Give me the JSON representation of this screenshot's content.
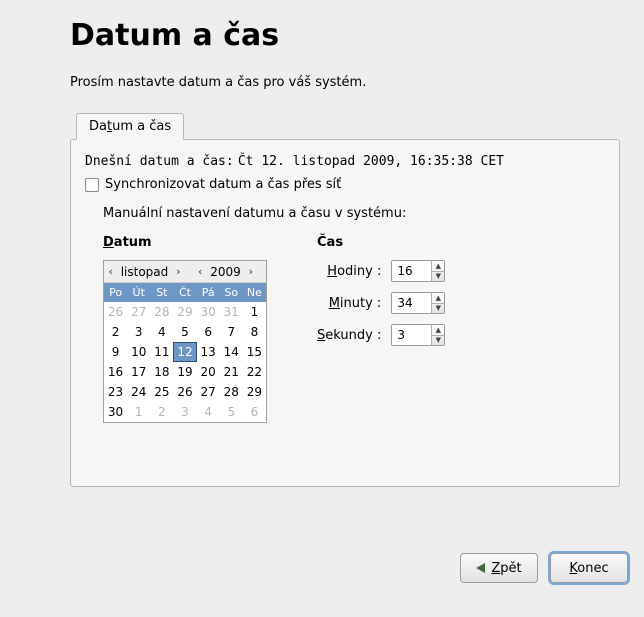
{
  "title": "Datum a čas",
  "subtitle": "Prosím nastavte datum a čas pro váš systém.",
  "tab_label": "Datum a čas",
  "current_label": "Dnešní datum a čas:",
  "current_value": "Čt 12. listopad 2009, 16:35:38 CET",
  "sync_label": "Synchronizovat datum a čas přes síť",
  "manual_label": "Manuální nastavení datumu a času v systému:",
  "date_heading": "Datum",
  "time_heading": "Čas",
  "calendar": {
    "month": "listopad",
    "year": "2009",
    "weekdays": [
      "Po",
      "Út",
      "St",
      "Čt",
      "Pá",
      "So",
      "Ne"
    ],
    "rows": [
      [
        {
          "d": "26",
          "o": true
        },
        {
          "d": "27",
          "o": true
        },
        {
          "d": "28",
          "o": true
        },
        {
          "d": "29",
          "o": true
        },
        {
          "d": "30",
          "o": true
        },
        {
          "d": "31",
          "o": true
        },
        {
          "d": "1"
        }
      ],
      [
        {
          "d": "2"
        },
        {
          "d": "3"
        },
        {
          "d": "4"
        },
        {
          "d": "5"
        },
        {
          "d": "6"
        },
        {
          "d": "7"
        },
        {
          "d": "8"
        }
      ],
      [
        {
          "d": "9"
        },
        {
          "d": "10"
        },
        {
          "d": "11"
        },
        {
          "d": "12",
          "sel": true
        },
        {
          "d": "13"
        },
        {
          "d": "14"
        },
        {
          "d": "15"
        }
      ],
      [
        {
          "d": "16"
        },
        {
          "d": "17"
        },
        {
          "d": "18"
        },
        {
          "d": "19"
        },
        {
          "d": "20"
        },
        {
          "d": "21"
        },
        {
          "d": "22"
        }
      ],
      [
        {
          "d": "23"
        },
        {
          "d": "24"
        },
        {
          "d": "25"
        },
        {
          "d": "26"
        },
        {
          "d": "27"
        },
        {
          "d": "28"
        },
        {
          "d": "29"
        }
      ],
      [
        {
          "d": "30"
        },
        {
          "d": "1",
          "o": true
        },
        {
          "d": "2",
          "o": true
        },
        {
          "d": "3",
          "o": true
        },
        {
          "d": "4",
          "o": true
        },
        {
          "d": "5",
          "o": true
        },
        {
          "d": "6",
          "o": true
        }
      ]
    ]
  },
  "time": {
    "hours_label": "Hodiny :",
    "minutes_label": "Minuty :",
    "seconds_label": "Sekundy :",
    "hours": "16",
    "minutes": "34",
    "seconds": "3"
  },
  "buttons": {
    "back": "Zpět",
    "finish": "Konec"
  }
}
